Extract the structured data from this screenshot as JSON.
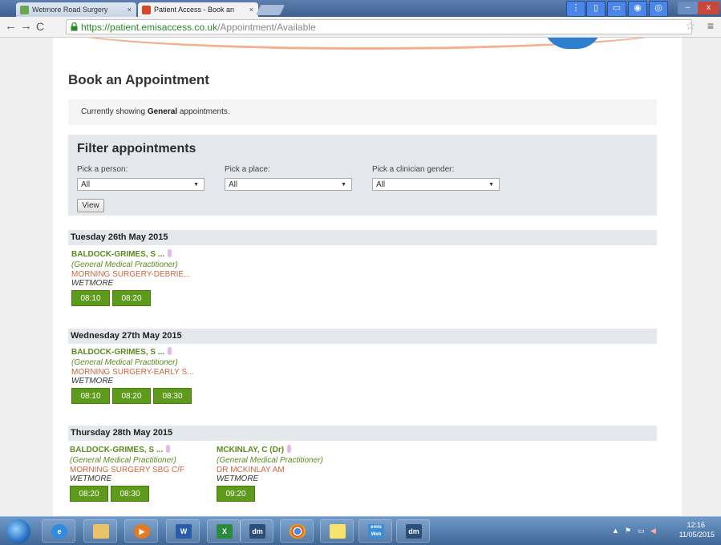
{
  "browser": {
    "tabs": [
      {
        "label": "Wetmore Road Surgery",
        "active": false
      },
      {
        "label": "Patient Access - Book an",
        "active": true
      }
    ],
    "url_secure": "https://patient.emisaccess.co.uk",
    "url_path": "/Appointment/Available"
  },
  "page": {
    "title": "Book an Appointment",
    "notice_prefix": "Currently showing",
    "notice_bold": "General",
    "notice_suffix": "appointments.",
    "filter": {
      "title": "Filter appointments",
      "person_label": "Pick a person:",
      "person_value": "All",
      "place_label": "Pick a place:",
      "place_value": "All",
      "gender_label": "Pick a clinician gender:",
      "gender_value": "All",
      "view_button": "View"
    },
    "days": [
      {
        "date": "Tuesday 26th May 2015",
        "appointments": [
          {
            "clinician": "BALDOCK-GRIMES, S ...",
            "role": "(General Medical Practitioner)",
            "session": "MORNING SURGERY-DEBRIE...",
            "place": "WETMORE",
            "slots": [
              "08:10",
              "08:20"
            ]
          }
        ]
      },
      {
        "date": "Wednesday 27th May 2015",
        "appointments": [
          {
            "clinician": "BALDOCK-GRIMES, S ...",
            "role": "(General Medical Practitioner)",
            "session": "MORNING SURGERY-EARLY S...",
            "place": "WETMORE",
            "slots": [
              "08:10",
              "08:20",
              "08:30"
            ]
          }
        ]
      },
      {
        "date": "Thursday 28th May 2015",
        "appointments": [
          {
            "clinician": "BALDOCK-GRIMES, S ...",
            "role": "(General Medical Practitioner)",
            "session": "MORNING SURGERY SBG C/F",
            "place": "WETMORE",
            "slots": [
              "08:20",
              "08:30"
            ]
          },
          {
            "clinician": "MCKINLAY, C (Dr)",
            "role": "(General Medical Practitioner)",
            "session": "DR MCKINLAY AM",
            "place": "WETMORE",
            "slots": [
              "09:20"
            ]
          }
        ]
      }
    ]
  },
  "taskbar": {
    "apps": [
      "ie",
      "explorer",
      "media-player",
      "word",
      "excel",
      "dm",
      "chrome",
      "sticky-notes",
      "emis-web",
      "dm"
    ],
    "app_labels": {
      "word": "W",
      "excel": "X",
      "dm": "dm",
      "emis": "emis Web"
    },
    "clock_time": "12:16",
    "clock_date": "11/05/2015"
  },
  "colors": {
    "accent_green": "#5e9a1b",
    "session_orange": "#d0643c",
    "panel_grey": "#e4e8ec"
  }
}
